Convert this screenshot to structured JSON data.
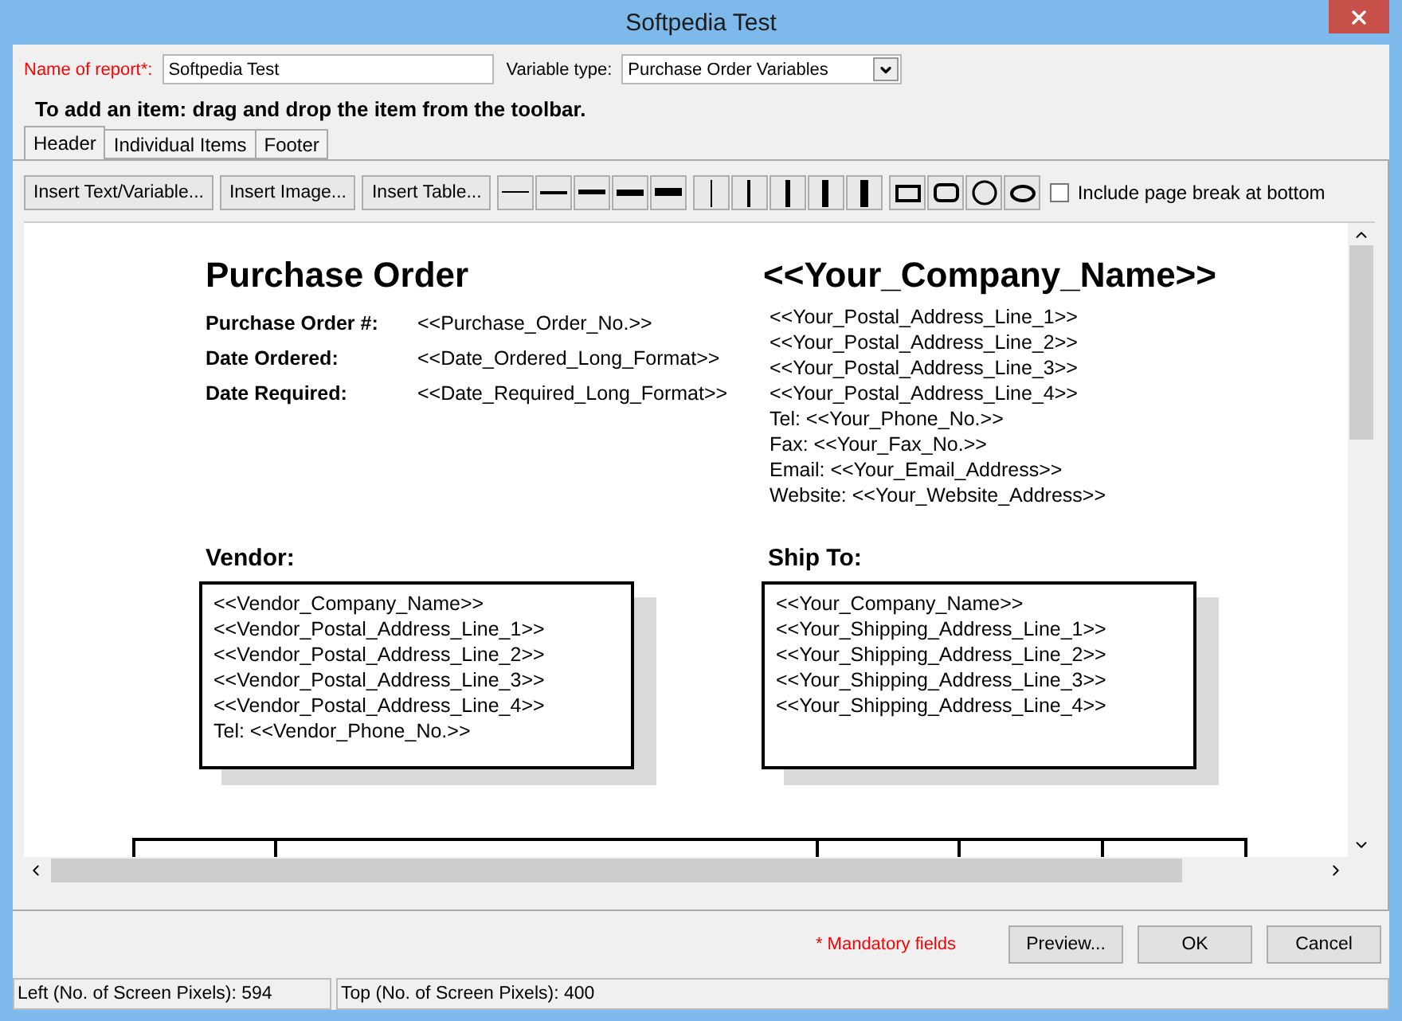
{
  "window": {
    "title": "Softpedia Test"
  },
  "report_name": {
    "label": "Name of report*:",
    "value": "Softpedia Test"
  },
  "variable_type": {
    "label": "Variable type:",
    "value": "Purchase Order Variables"
  },
  "instruction": "To add an item: drag and drop the item from the toolbar.",
  "tabs": [
    {
      "label": "Header",
      "selected": true
    },
    {
      "label": "Individual Items",
      "selected": false
    },
    {
      "label": "Footer",
      "selected": false
    }
  ],
  "toolbar": {
    "buttons": [
      "Insert Text/Variable...",
      "Insert Image...",
      "Insert Table..."
    ],
    "page_break": {
      "label": "Include page break at bottom",
      "checked": false
    }
  },
  "document": {
    "title": "Purchase Order",
    "fields": [
      {
        "label": "Purchase Order #:",
        "value": "<<Purchase_Order_No.>>"
      },
      {
        "label": "Date Ordered:",
        "value": "<<Date_Ordered_Long_Format>>"
      },
      {
        "label": "Date Required:",
        "value": "<<Date_Required_Long_Format>>"
      }
    ],
    "company_name": "<<Your_Company_Name>>",
    "company_lines": [
      "<<Your_Postal_Address_Line_1>>",
      "<<Your_Postal_Address_Line_2>>",
      "<<Your_Postal_Address_Line_3>>",
      "<<Your_Postal_Address_Line_4>>",
      "Tel: <<Your_Phone_No.>>",
      "Fax: <<Your_Fax_No.>>",
      "Email: <<Your_Email_Address>>",
      "Website: <<Your_Website_Address>>"
    ],
    "vendor": {
      "heading": "Vendor:",
      "lines": [
        "<<Vendor_Company_Name>>",
        "<<Vendor_Postal_Address_Line_1>>",
        "<<Vendor_Postal_Address_Line_2>>",
        "<<Vendor_Postal_Address_Line_3>>",
        "<<Vendor_Postal_Address_Line_4>>",
        "Tel: <<Vendor_Phone_No.>>"
      ]
    },
    "ship_to": {
      "heading": "Ship To:",
      "lines": [
        "<<Your_Company_Name>>",
        "<<Your_Shipping_Address_Line_1>>",
        "<<Your_Shipping_Address_Line_2>>",
        "<<Your_Shipping_Address_Line_3>>",
        "<<Your_Shipping_Address_Line_4>>"
      ]
    }
  },
  "footer": {
    "mandatory_note": "* Mandatory fields",
    "buttons": [
      "Preview...",
      "OK",
      "Cancel"
    ]
  },
  "status_bar": [
    "Left (No. of Screen Pixels): 594",
    "Top (No. of Screen Pixels): 400"
  ]
}
